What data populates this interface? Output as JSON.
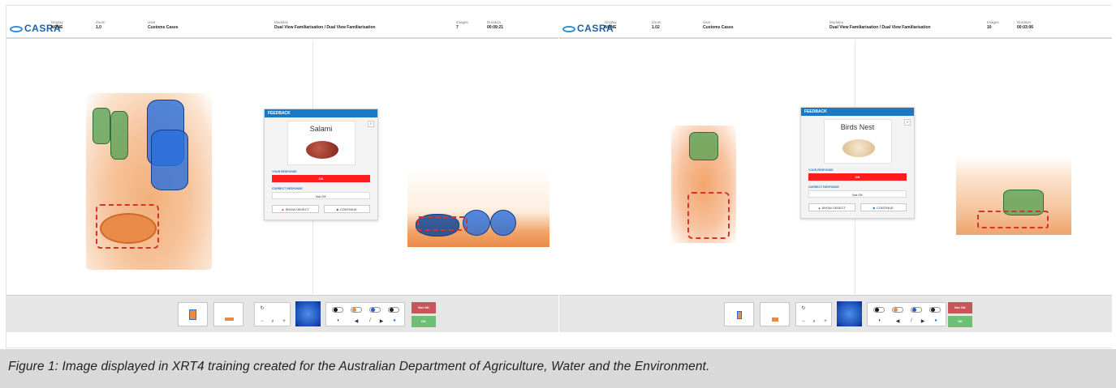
{
  "left": {
    "logo": "CASRA",
    "meta": [
      {
        "label": "Display",
        "value": "NONE"
      },
      {
        "label": "Zoom",
        "value": "1.0"
      },
      {
        "label": "User",
        "value": "Customs Cases"
      },
      {
        "label": "Modules",
        "value": "Dual View Familiarisation / Dual View Familiarisation"
      },
      {
        "label": "Images",
        "value": "7"
      },
      {
        "label": "Duration",
        "value": "00:09:21"
      }
    ],
    "feedback": {
      "header": "FEEDBACK",
      "item_name": "Salami",
      "your_response_label": "YOUR RESPONSE",
      "your_response": "OK",
      "correct_response_label": "CORRECT RESPONSE",
      "correct_response": "Not OK",
      "show_object": "SHOW OBJECT",
      "continue": "CONTINUE"
    },
    "toolbar": {
      "not_ok": "Not OK",
      "ok": "OK"
    }
  },
  "right": {
    "logo": "CASRA",
    "meta": [
      {
        "label": "Display",
        "value": "NONE"
      },
      {
        "label": "Zoom",
        "value": "1.02"
      },
      {
        "label": "User",
        "value": "Customs Cases"
      },
      {
        "label": "Modules",
        "value": "Dual View Familiarisation / Dual View Familiarisation"
      },
      {
        "label": "Images",
        "value": "10"
      },
      {
        "label": "Duration",
        "value": "00:03:06"
      }
    ],
    "feedback": {
      "header": "FEEDBACK",
      "item_name": "Birds Nest",
      "your_response_label": "YOUR RESPONSE",
      "your_response": "OK",
      "correct_response_label": "CORRECT RESPONSE",
      "correct_response": "Not OK",
      "show_object": "SHOW OBJECT",
      "continue": "CONTINUE"
    },
    "toolbar": {
      "not_ok": "Not OK",
      "ok": "OK"
    }
  },
  "colors": {
    "accent": "#1b78c4",
    "alert": "#ff1c1c",
    "ok": "#6cbf73",
    "not_ok": "#c9555a"
  },
  "caption": "Figure 1: Image displayed in XRT4 training created for the Australian Department of Agriculture, Water and the Environment."
}
